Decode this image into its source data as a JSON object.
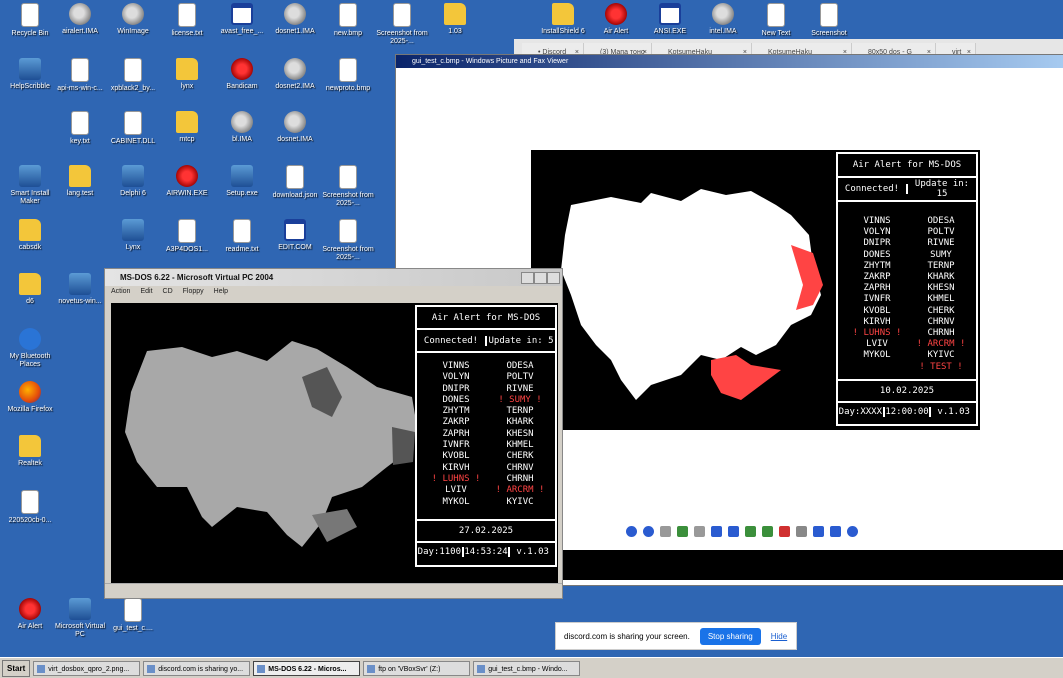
{
  "desktop_icons": [
    {
      "label": "Recycle Bin",
      "icon": "recycle-bin-icon",
      "kind": "doc"
    },
    {
      "label": "airalert.IMA",
      "icon": "disk-image-icon",
      "kind": "disk"
    },
    {
      "label": "WinImage",
      "icon": "winimage-icon",
      "kind": "disk"
    },
    {
      "label": "license.txt",
      "icon": "text-file-icon",
      "kind": "doc"
    },
    {
      "label": "avast_free_...",
      "icon": "window-icon",
      "kind": "win"
    },
    {
      "label": "dosnet1.IMA",
      "icon": "disk-image-icon",
      "kind": "disk"
    },
    {
      "label": "new.bmp",
      "icon": "bitmap-icon",
      "kind": "doc"
    },
    {
      "label": "Screenshot from 2025-...",
      "icon": "image-icon",
      "kind": "doc"
    },
    {
      "label": "1.03",
      "icon": "folder-icon",
      "kind": "folder"
    },
    {
      "label": "HelpScribble",
      "icon": "helpscribble-icon",
      "kind": "app"
    },
    {
      "label": "api-ms-win-c...",
      "icon": "dll-icon",
      "kind": "doc"
    },
    {
      "label": "xpblack2_by...",
      "icon": "archive-icon",
      "kind": "doc"
    },
    {
      "label": "lynx",
      "icon": "folder-icon",
      "kind": "folder"
    },
    {
      "label": "Bandicam",
      "icon": "bandicam-icon",
      "kind": "red"
    },
    {
      "label": "dosnet2.IMA",
      "icon": "disk-image-icon",
      "kind": "disk"
    },
    {
      "label": "newproto.bmp",
      "icon": "bitmap-icon",
      "kind": "doc"
    },
    {
      "label": "key.txt",
      "icon": "text-file-icon",
      "kind": "doc"
    },
    {
      "label": "CABINET.DLL",
      "icon": "dll-icon",
      "kind": "doc"
    },
    {
      "label": "mtcp",
      "icon": "folder-icon",
      "kind": "folder"
    },
    {
      "label": "bl.IMA",
      "icon": "disk-image-icon",
      "kind": "disk"
    },
    {
      "label": "dosnet.IMA",
      "icon": "disk-image-icon",
      "kind": "disk"
    },
    {
      "label": "Smart Install Maker",
      "icon": "installer-icon",
      "kind": "app"
    },
    {
      "label": "lang.test",
      "icon": "folder-icon",
      "kind": "folder"
    },
    {
      "label": "Delphi 6",
      "icon": "delphi-icon",
      "kind": "app"
    },
    {
      "label": "AIRWIN.EXE",
      "icon": "air-alert-icon",
      "kind": "red"
    },
    {
      "label": "Setup.exe",
      "icon": "setup-icon",
      "kind": "app"
    },
    {
      "label": "download.json",
      "icon": "text-file-icon",
      "kind": "doc"
    },
    {
      "label": "Screenshot from 2025-...",
      "icon": "image-icon",
      "kind": "doc"
    },
    {
      "label": "cabsdk",
      "icon": "folder-icon",
      "kind": "folder"
    },
    {
      "label": "Lynx",
      "icon": "lynx-icon",
      "kind": "app"
    },
    {
      "label": "A3P4DOS1...",
      "icon": "text-file-icon",
      "kind": "doc"
    },
    {
      "label": "readme.txt",
      "icon": "text-file-icon",
      "kind": "doc"
    },
    {
      "label": "EDIT.COM",
      "icon": "window-icon",
      "kind": "win"
    },
    {
      "label": "Screenshot from 2025-...",
      "icon": "image-icon",
      "kind": "doc"
    },
    {
      "label": "d6",
      "icon": "folder-icon",
      "kind": "folder"
    },
    {
      "label": "novetus-win...",
      "icon": "archive-icon",
      "kind": "app"
    },
    {
      "label": "My Bluetooth Places",
      "icon": "bluetooth-icon",
      "kind": "bt"
    },
    {
      "label": "Mozilla Firefox",
      "icon": "firefox-icon",
      "kind": "ff"
    },
    {
      "label": "Realtek",
      "icon": "folder-icon",
      "kind": "folder"
    },
    {
      "label": "220520cb-0...",
      "icon": "image-icon",
      "kind": "doc"
    },
    {
      "label": "Air Alert",
      "icon": "air-alert-icon",
      "kind": "red"
    },
    {
      "label": "Microsoft Virtual PC",
      "icon": "virtual-pc-icon",
      "kind": "app"
    },
    {
      "label": "gui_test_c....",
      "icon": "bitmap-icon",
      "kind": "doc"
    },
    {
      "label": "InstallShield 6",
      "icon": "folder-icon",
      "kind": "folder"
    },
    {
      "label": "Air Alert",
      "icon": "air-alert-icon",
      "kind": "red"
    },
    {
      "label": "ANSI.EXE",
      "icon": "window-icon",
      "kind": "win"
    },
    {
      "label": "intel.IMA",
      "icon": "disk-image-icon",
      "kind": "disk"
    },
    {
      "label": "New Text",
      "icon": "text-file-icon",
      "kind": "doc"
    },
    {
      "label": "Screenshot",
      "icon": "image-icon",
      "kind": "doc"
    }
  ],
  "browser": {
    "tabs": [
      "• Discord",
      "(3) Мапа тоно",
      "KotsumeHaku",
      "KotsumeHaku",
      "80x50 dos - G",
      "virt"
    ]
  },
  "viewer": {
    "title": "gui_test_c.bmp - Windows Picture and Fax Viewer"
  },
  "dos_big": {
    "header": "Air Alert for MS-DOS",
    "status": "Connected!",
    "update": "Update in: 15",
    "regions_left": [
      "VINNS",
      "VOLYN",
      "DNIPR",
      "DONES",
      "ZHYTM",
      "ZAKRP",
      "ZAPRH",
      "IVNFR",
      "KVOBL",
      "KIRVH",
      "LUHNS",
      "LVIV",
      "MYKOL"
    ],
    "alert_left": [
      false,
      false,
      false,
      false,
      false,
      false,
      false,
      false,
      false,
      false,
      true,
      false,
      false
    ],
    "regions_right": [
      "ODESA",
      "POLTV",
      "RIVNE",
      "SUMY",
      "TERNP",
      "KHARK",
      "KHESN",
      "KHMEL",
      "CHERK",
      "CHRNV",
      "CHRNH",
      "ARCRM",
      "KYIVC",
      "TEST"
    ],
    "alert_right": [
      false,
      false,
      false,
      false,
      false,
      false,
      false,
      false,
      false,
      false,
      false,
      true,
      false,
      true
    ],
    "date": "10.02.2025",
    "day": "Day:XXXX",
    "time": "12:00:00",
    "version": "v.1.03"
  },
  "vpc": {
    "title": "MS-DOS 6.22 - Microsoft Virtual PC 2004",
    "menu": [
      "Action",
      "Edit",
      "CD",
      "Floppy",
      "Help"
    ]
  },
  "dos_small": {
    "header": "Air Alert for MS-DOS",
    "status": "Connected!",
    "update": "Update in: 5",
    "regions_left": [
      "VINNS",
      "VOLYN",
      "DNIPR",
      "DONES",
      "ZHYTM",
      "ZAKRP",
      "ZAPRH",
      "IVNFR",
      "KVOBL",
      "KIRVH",
      "LUHNS",
      "LVIV",
      "MYKOL"
    ],
    "alert_left": [
      false,
      false,
      false,
      false,
      false,
      false,
      false,
      false,
      false,
      false,
      true,
      false,
      false
    ],
    "regions_right": [
      "ODESA",
      "POLTV",
      "RIVNE",
      "SUMY",
      "TERNP",
      "KHARK",
      "KHESN",
      "KHMEL",
      "CHERK",
      "CHRNV",
      "CHRNH",
      "ARCRM",
      "KYIVC"
    ],
    "alert_right": [
      false,
      false,
      false,
      true,
      false,
      false,
      false,
      false,
      false,
      false,
      false,
      true,
      false
    ],
    "date": "27.02.2025",
    "day": "Day:1100",
    "time": "14:53:24",
    "version": "v.1.03"
  },
  "share": {
    "message": "discord.com is sharing your screen.",
    "stop": "Stop sharing",
    "hide": "Hide"
  },
  "taskbar": {
    "start": "Start",
    "items": [
      "virt_dosbox_qpro_2.png...",
      "discord.com is sharing yo...",
      "MS-DOS 6.22 - Micros...",
      "ftp on 'VBoxSvr' (Z:)",
      "gui_test_c.bmp - Windo..."
    ],
    "active_index": 2
  },
  "colors": {
    "alert": "#ff4444",
    "map_white": "#ffffff",
    "map_gray": "#a8a8a8",
    "desktop": "#2f66b3"
  }
}
